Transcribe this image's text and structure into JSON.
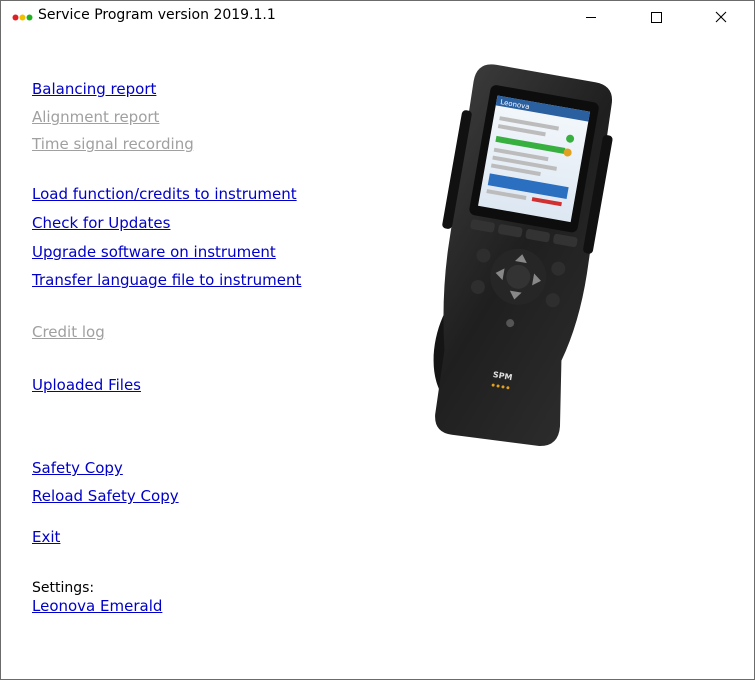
{
  "window": {
    "title": "Service Program version 2019.1.1",
    "controls": {
      "minimize": "—",
      "maximize": "☐",
      "close": "✕"
    }
  },
  "menu": {
    "balancing_report": {
      "label": "Balancing report",
      "enabled": true
    },
    "alignment_report": {
      "label": "Alignment report",
      "enabled": false
    },
    "time_signal_recording": {
      "label": "Time signal recording",
      "enabled": false
    },
    "load_function": {
      "label": "Load function/credits to instrument",
      "enabled": true
    },
    "check_updates": {
      "label": "Check for Updates",
      "enabled": true
    },
    "upgrade_software": {
      "label": "Upgrade software on instrument",
      "enabled": true
    },
    "transfer_language": {
      "label": "Transfer language file to instrument",
      "enabled": true
    },
    "credit_log": {
      "label": "Credit log",
      "enabled": false
    },
    "uploaded_files": {
      "label": "Uploaded Files",
      "enabled": true
    },
    "safety_copy": {
      "label": "Safety Copy",
      "enabled": true
    },
    "reload_safety_copy": {
      "label": "Reload Safety Copy",
      "enabled": true
    },
    "exit": {
      "label": "Exit",
      "enabled": true
    }
  },
  "settings": {
    "label": "Settings:",
    "instrument": "Leonova Emerald"
  },
  "colors": {
    "link": "#0000c8",
    "disabled": "#a0a0a0",
    "icon_dots": [
      "#e02020",
      "#f0c000",
      "#20b020"
    ]
  },
  "device": {
    "brand": "Leonova",
    "logo": "SPM"
  }
}
